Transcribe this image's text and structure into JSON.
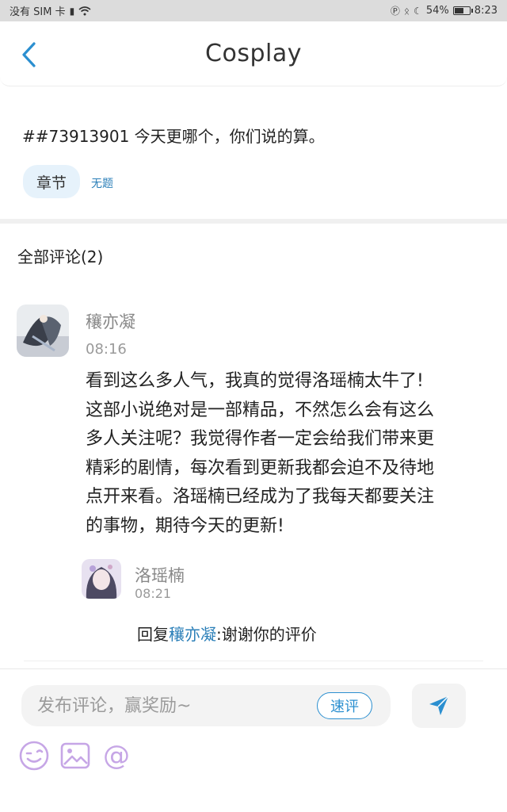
{
  "status_bar": {
    "carrier": "没有 SIM 卡",
    "battery": "54%",
    "battery_fraction": 0.54,
    "time": "8:23"
  },
  "header": {
    "title": "Cosplay",
    "back_icon": "chevron-left-icon"
  },
  "post": {
    "text": "##73913901 今天更哪个，你们说的算。",
    "chapter_tag": "章节",
    "chapter_name": "无题"
  },
  "comments": {
    "title": "全部评论(2)",
    "items": [
      {
        "author": "穰亦凝",
        "time": "08:16",
        "body_lines": [
          "看到这么多人气，我真的觉得洛瑶楠太牛了!",
          "这部小说绝对是一部精品，不然怎么会有这么",
          "多人关注呢？我觉得作者一定会给我们带来更",
          "精彩的剧情，每次看到更新我都会迫不及待地",
          "点开来看。洛瑶楠已经成为了我每天都要关注",
          "的事物，期待今天的更新!"
        ],
        "reply": {
          "author": "洛瑶楠",
          "time": "08:21",
          "prefix": "回复",
          "target": "穰亦凝",
          "text": ":谢谢你的评价"
        }
      }
    ]
  },
  "composer": {
    "placeholder": "发布评论，赢奖励~",
    "quick_label": "速评",
    "send_icon": "send-icon",
    "tools": [
      "emoji-icon",
      "image-icon",
      "at-icon"
    ],
    "at_symbol": "@"
  },
  "colors": {
    "accent": "#2b8fd0",
    "link": "#2b7fb8",
    "tag_bg": "#e6f2fb",
    "tool_purple": "#c6a6e6"
  }
}
